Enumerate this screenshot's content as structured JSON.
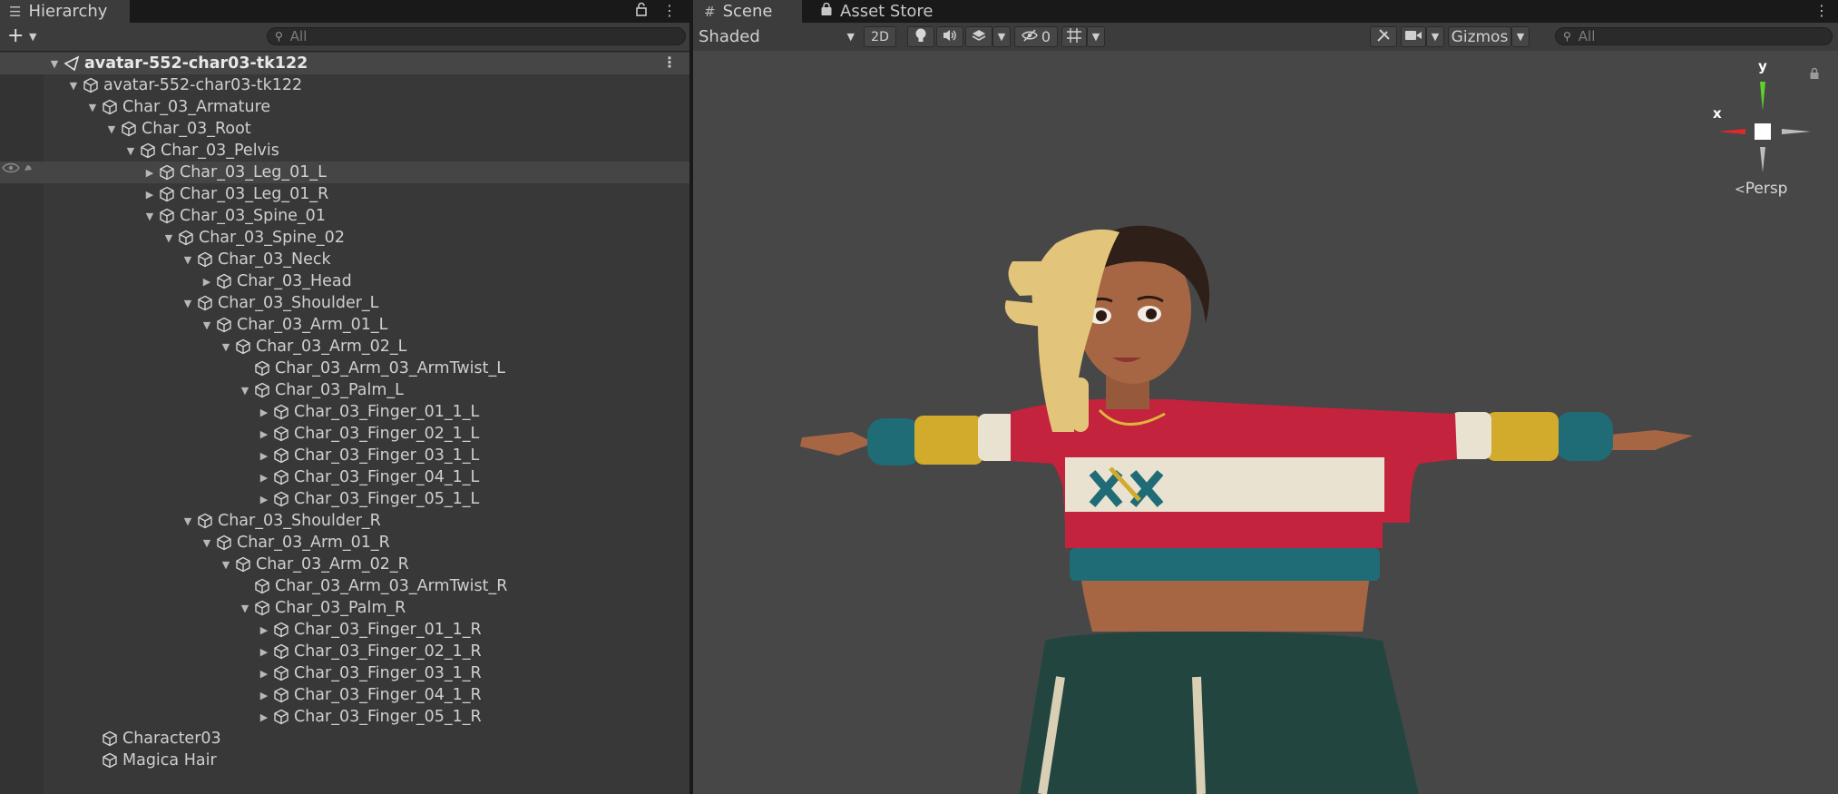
{
  "hierarchy": {
    "tab_title": "Hierarchy",
    "search_placeholder": "All",
    "rows": [
      {
        "label": "avatar-552-char03-tk122",
        "depth": 0,
        "arrow": "down",
        "icon": "unity-scene-icon",
        "scene": true
      },
      {
        "label": "avatar-552-char03-tk122",
        "depth": 1,
        "arrow": "down",
        "icon": "gameobject-cube-icon"
      },
      {
        "label": "Char_03_Armature",
        "depth": 2,
        "arrow": "down",
        "icon": "gameobject-cube-icon"
      },
      {
        "label": "Char_03_Root",
        "depth": 3,
        "arrow": "down",
        "icon": "gameobject-cube-icon"
      },
      {
        "label": "Char_03_Pelvis",
        "depth": 4,
        "arrow": "down",
        "icon": "gameobject-cube-icon"
      },
      {
        "label": "Char_03_Leg_01_L",
        "depth": 5,
        "arrow": "right",
        "icon": "gameobject-cube-icon",
        "highlight": true
      },
      {
        "label": "Char_03_Leg_01_R",
        "depth": 5,
        "arrow": "right",
        "icon": "gameobject-cube-icon"
      },
      {
        "label": "Char_03_Spine_01",
        "depth": 5,
        "arrow": "down",
        "icon": "gameobject-cube-icon"
      },
      {
        "label": "Char_03_Spine_02",
        "depth": 6,
        "arrow": "down",
        "icon": "gameobject-cube-icon"
      },
      {
        "label": "Char_03_Neck",
        "depth": 7,
        "arrow": "down",
        "icon": "gameobject-cube-icon"
      },
      {
        "label": "Char_03_Head",
        "depth": 8,
        "arrow": "right",
        "icon": "gameobject-cube-icon"
      },
      {
        "label": "Char_03_Shoulder_L",
        "depth": 7,
        "arrow": "down",
        "icon": "gameobject-cube-icon"
      },
      {
        "label": "Char_03_Arm_01_L",
        "depth": 8,
        "arrow": "down",
        "icon": "gameobject-cube-icon"
      },
      {
        "label": "Char_03_Arm_02_L",
        "depth": 9,
        "arrow": "down",
        "icon": "gameobject-cube-icon"
      },
      {
        "label": "Char_03_Arm_03_ArmTwist_L",
        "depth": 10,
        "arrow": "",
        "icon": "gameobject-cube-icon"
      },
      {
        "label": "Char_03_Palm_L",
        "depth": 10,
        "arrow": "down",
        "icon": "gameobject-cube-icon"
      },
      {
        "label": "Char_03_Finger_01_1_L",
        "depth": 11,
        "arrow": "right",
        "icon": "gameobject-cube-icon"
      },
      {
        "label": "Char_03_Finger_02_1_L",
        "depth": 11,
        "arrow": "right",
        "icon": "gameobject-cube-icon"
      },
      {
        "label": "Char_03_Finger_03_1_L",
        "depth": 11,
        "arrow": "right",
        "icon": "gameobject-cube-icon"
      },
      {
        "label": "Char_03_Finger_04_1_L",
        "depth": 11,
        "arrow": "right",
        "icon": "gameobject-cube-icon"
      },
      {
        "label": "Char_03_Finger_05_1_L",
        "depth": 11,
        "arrow": "right",
        "icon": "gameobject-cube-icon"
      },
      {
        "label": "Char_03_Shoulder_R",
        "depth": 7,
        "arrow": "down",
        "icon": "gameobject-cube-icon"
      },
      {
        "label": "Char_03_Arm_01_R",
        "depth": 8,
        "arrow": "down",
        "icon": "gameobject-cube-icon"
      },
      {
        "label": "Char_03_Arm_02_R",
        "depth": 9,
        "arrow": "down",
        "icon": "gameobject-cube-icon"
      },
      {
        "label": "Char_03_Arm_03_ArmTwist_R",
        "depth": 10,
        "arrow": "",
        "icon": "gameobject-cube-icon"
      },
      {
        "label": "Char_03_Palm_R",
        "depth": 10,
        "arrow": "down",
        "icon": "gameobject-cube-icon"
      },
      {
        "label": "Char_03_Finger_01_1_R",
        "depth": 11,
        "arrow": "right",
        "icon": "gameobject-cube-icon"
      },
      {
        "label": "Char_03_Finger_02_1_R",
        "depth": 11,
        "arrow": "right",
        "icon": "gameobject-cube-icon"
      },
      {
        "label": "Char_03_Finger_03_1_R",
        "depth": 11,
        "arrow": "right",
        "icon": "gameobject-cube-icon"
      },
      {
        "label": "Char_03_Finger_04_1_R",
        "depth": 11,
        "arrow": "right",
        "icon": "gameobject-cube-icon"
      },
      {
        "label": "Char_03_Finger_05_1_R",
        "depth": 11,
        "arrow": "right",
        "icon": "gameobject-cube-icon"
      },
      {
        "label": "Character03",
        "depth": 2,
        "arrow": "",
        "icon": "gameobject-cube-icon"
      },
      {
        "label": "Magica Hair",
        "depth": 2,
        "arrow": "",
        "icon": "gameobject-cube-icon"
      }
    ]
  },
  "scene": {
    "tabs": [
      {
        "label": "Scene",
        "icon": "grid-icon"
      },
      {
        "label": "Asset Store",
        "icon": "shopping-bag-icon"
      }
    ],
    "toolbar": {
      "shading_mode": "Shaded",
      "btn_2d": "2D",
      "hidden_count": "0",
      "gizmos_label": "Gizmos",
      "search_placeholder": "All"
    },
    "gizmo": {
      "x_label": "x",
      "y_label": "y",
      "projection_label": "Persp"
    }
  },
  "colors": {
    "axis_x": "#e02a2a",
    "axis_y": "#5ed12a",
    "viewport_bg": "#474747",
    "panel_bg": "#383838",
    "shirt_red": "#c3233d",
    "shirt_yellow": "#d2ab2c",
    "shirt_teal": "#1f6b76",
    "pants_green": "#234540",
    "skin": "#a66644",
    "hair_blonde": "#e2c57a"
  }
}
